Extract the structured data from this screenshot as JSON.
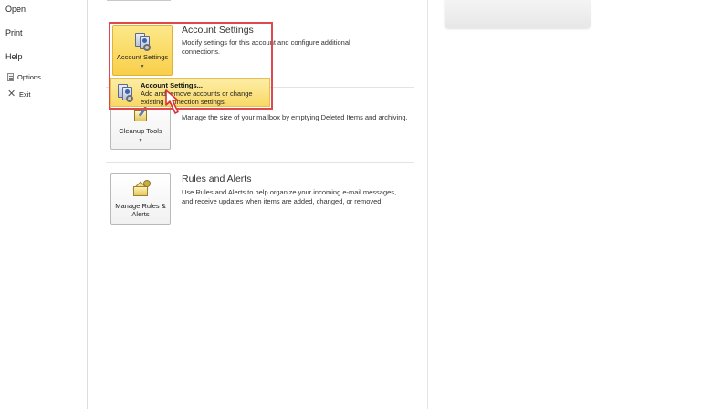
{
  "nav": {
    "open": "Open",
    "print": "Print",
    "help": "Help",
    "options": "Options",
    "exit": "Exit"
  },
  "account_settings": {
    "button_label": "Account Settings",
    "title": "Account Settings",
    "description": "Modify settings for this account and configure additional connections.",
    "menu_item_title": "Account Settings...",
    "menu_item_description": "Add and remove accounts or change existing connection settings."
  },
  "cleanup": {
    "button_label": "Cleanup Tools",
    "description": "Manage the size of your mailbox by emptying Deleted Items and archiving."
  },
  "rules": {
    "button_label": "Manage Rules & Alerts",
    "title": "Rules and Alerts",
    "description": "Use Rules and Alerts to help organize your incoming e-mail messages, and receive updates when items are added, changed, or removed."
  },
  "colors": {
    "highlight_border": "#e0484c",
    "active_button": "#f8cf4a",
    "menu_hover": "#f9d867"
  },
  "icons": {
    "account_settings": "account-settings-icon",
    "cleanup": "cleanup-tools-icon",
    "rules": "rules-alerts-icon",
    "options": "options-icon",
    "exit": "exit-icon"
  }
}
